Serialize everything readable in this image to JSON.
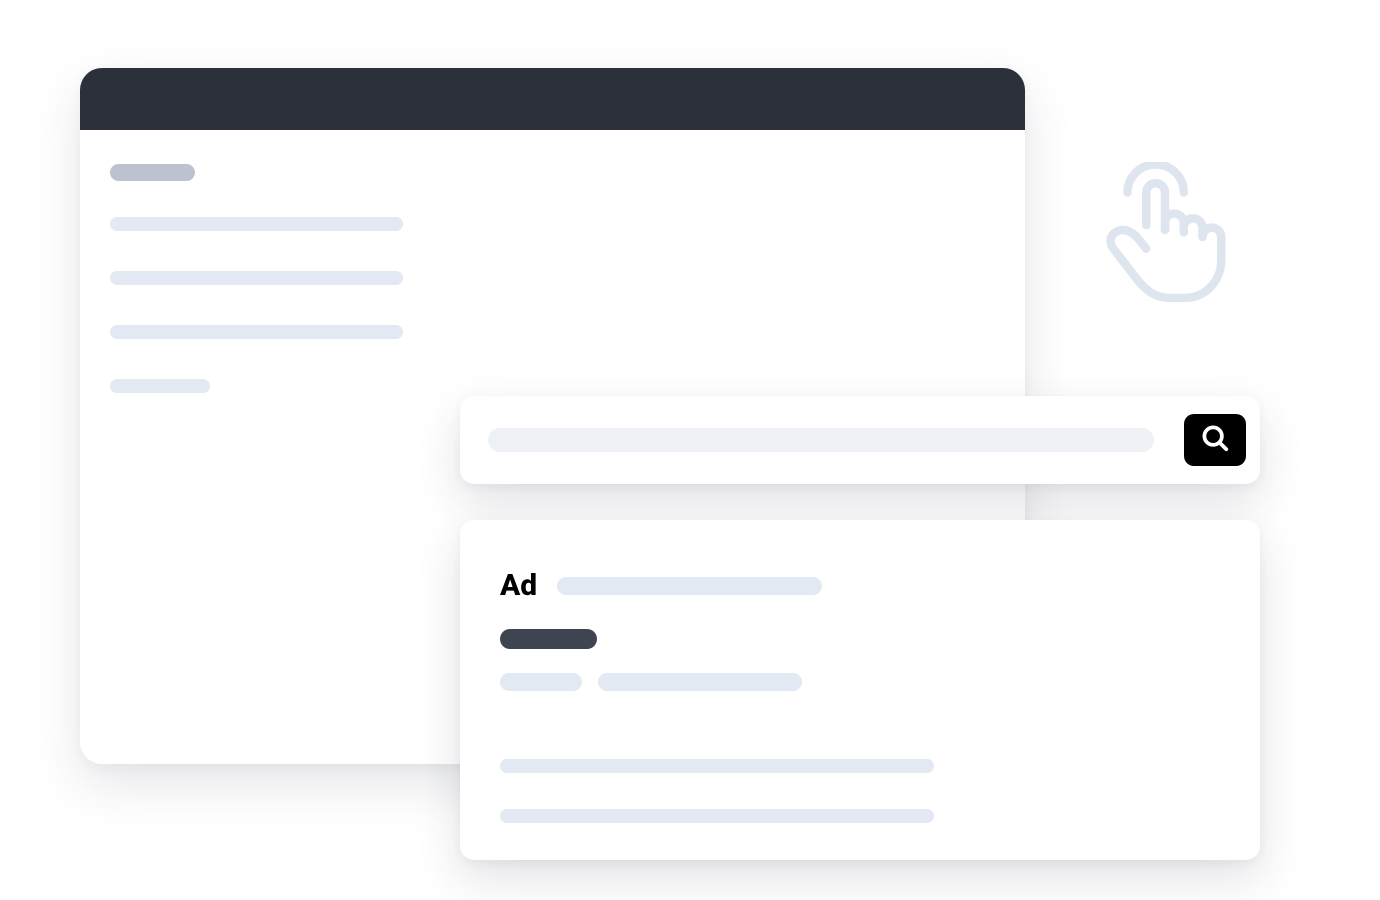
{
  "colors": {
    "title_bar": "#2b303b",
    "placeholder": "#e3e9f2",
    "placeholder_muted": "#bcc3ce",
    "placeholder_dark": "#3f4550",
    "search_button_bg": "#000000",
    "tap_icon": "#dfe5ef"
  },
  "ad_result": {
    "label": "Ad"
  }
}
